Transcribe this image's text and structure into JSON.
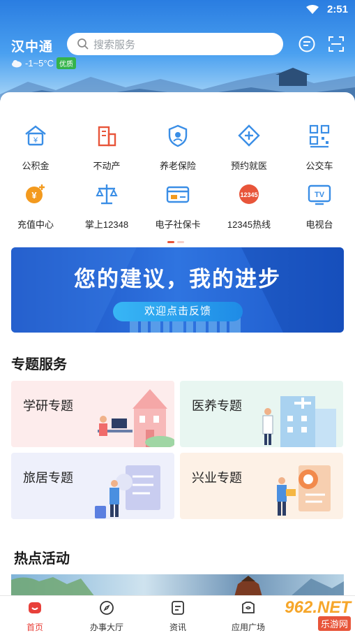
{
  "status": {
    "time": "2:51"
  },
  "header": {
    "city": "汉中通",
    "weather": {
      "temp": "-1~5°C",
      "quality": "优质"
    },
    "search_placeholder": "搜索服务"
  },
  "services": [
    {
      "label": "公积金",
      "icon": "housing-fund-icon",
      "color": "#3a8ee6"
    },
    {
      "label": "不动产",
      "icon": "real-estate-icon",
      "color": "#e8553a"
    },
    {
      "label": "养老保险",
      "icon": "pension-insurance-icon",
      "color": "#3a8ee6"
    },
    {
      "label": "预约就医",
      "icon": "medical-appointment-icon",
      "color": "#3a8ee6"
    },
    {
      "label": "公交车",
      "icon": "bus-qr-icon",
      "color": "#3a8ee6"
    },
    {
      "label": "充值中心",
      "icon": "recharge-icon",
      "color": "#f39a1e"
    },
    {
      "label": "掌上12348",
      "icon": "legal-scale-icon",
      "color": "#3a8ee6"
    },
    {
      "label": "电子社保卡",
      "icon": "social-security-card-icon",
      "color": "#3a8ee6"
    },
    {
      "label": "12345热线",
      "icon": "hotline-12345-icon",
      "color": "#e8553a"
    },
    {
      "label": "电视台",
      "icon": "tv-icon",
      "color": "#3a8ee6"
    }
  ],
  "banner": {
    "title": "您的建议，我的进步",
    "button": "欢迎点击反馈"
  },
  "topics": {
    "heading": "专题服务",
    "items": [
      {
        "label": "学研专题",
        "bg": "#fdecec"
      },
      {
        "label": "医养专题",
        "bg": "#e8f6f1"
      },
      {
        "label": "旅居专题",
        "bg": "#eef0fb"
      },
      {
        "label": "兴业专题",
        "bg": "#fdf1e6"
      }
    ]
  },
  "hot": {
    "heading": "热点活动"
  },
  "tabs": [
    {
      "label": "首页",
      "icon": "home-icon",
      "active": true
    },
    {
      "label": "办事大厅",
      "icon": "compass-icon",
      "active": false
    },
    {
      "label": "资讯",
      "icon": "news-icon",
      "active": false
    },
    {
      "label": "应用广场",
      "icon": "app-square-icon",
      "active": false
    }
  ],
  "watermark": {
    "brand": "962.NET",
    "sub": "乐游网"
  },
  "colors": {
    "accent": "#e8403a",
    "primary": "#2a7de1"
  }
}
